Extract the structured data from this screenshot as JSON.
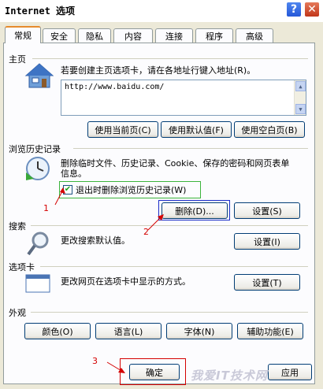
{
  "window": {
    "title": "Internet 选项",
    "help_label": "?",
    "close_label": "✕"
  },
  "tabs": [
    {
      "label": "常规",
      "active": true
    },
    {
      "label": "安全"
    },
    {
      "label": "隐私"
    },
    {
      "label": "内容"
    },
    {
      "label": "连接"
    },
    {
      "label": "程序"
    },
    {
      "label": "高级"
    }
  ],
  "homepage": {
    "label": "主页",
    "description": "若要创建主页选项卡，请在各地址行键入地址(R)。",
    "url": "http://www.baidu.com/",
    "buttons": {
      "current": "使用当前页(C)",
      "default": "使用默认值(F)",
      "blank": "使用空白页(B)"
    }
  },
  "history": {
    "label": "浏览历史记录",
    "description": "删除临时文件、历史记录、Cookie、保存的密码和网页表单信息。",
    "checkbox_label": "退出时删除浏览历史记录(W)",
    "checkbox_checked": true,
    "buttons": {
      "delete": "删除(D)...",
      "settings": "设置(S)"
    }
  },
  "search": {
    "label": "搜索",
    "description": "更改搜索默认值。",
    "settings_button": "设置(I)"
  },
  "tabs_section": {
    "label": "选项卡",
    "description": "更改网页在选项卡中显示的方式。",
    "settings_button": "设置(T)"
  },
  "appearance": {
    "label": "外观",
    "buttons": {
      "colors": "颜色(O)",
      "languages": "语言(L)",
      "fonts": "字体(N)",
      "accessibility": "辅助功能(E)"
    }
  },
  "footer": {
    "ok": "确定",
    "apply": "应用"
  },
  "annotations": {
    "n1": "1",
    "n2": "2",
    "n3": "3"
  },
  "watermark": "我爱IT技术网",
  "colors": {
    "annotation": "#d40000",
    "checkbox_highlight": "#3cb43c",
    "focus_box": "#1a2cc8",
    "tab_accent": "#e68b2c"
  }
}
